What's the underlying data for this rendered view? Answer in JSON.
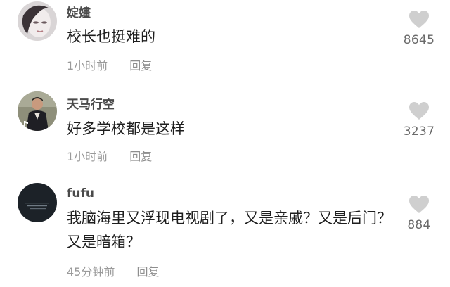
{
  "comments": [
    {
      "username": "婝嫿",
      "text": "校长也挺难的",
      "time": "1小时前",
      "reply_label": "回复",
      "likes": "8645",
      "avatar_icon": "portrait-avatar"
    },
    {
      "username": "天马行空",
      "text": "好多学校都是这样",
      "time": "1小时前",
      "reply_label": "回复",
      "likes": "3237",
      "avatar_icon": "portrait-avatar"
    },
    {
      "username": "fufu",
      "text": "我脑海里又浮现电视剧了，又是亲戚？又是后门？又是暗箱？",
      "time": "45分钟前",
      "reply_label": "回复",
      "likes": "884",
      "avatar_icon": "dark-text-avatar"
    }
  ],
  "colors": {
    "heart": "#cfcfcf",
    "meta_text": "#9a9a9a",
    "username": "#4a4a4a"
  }
}
